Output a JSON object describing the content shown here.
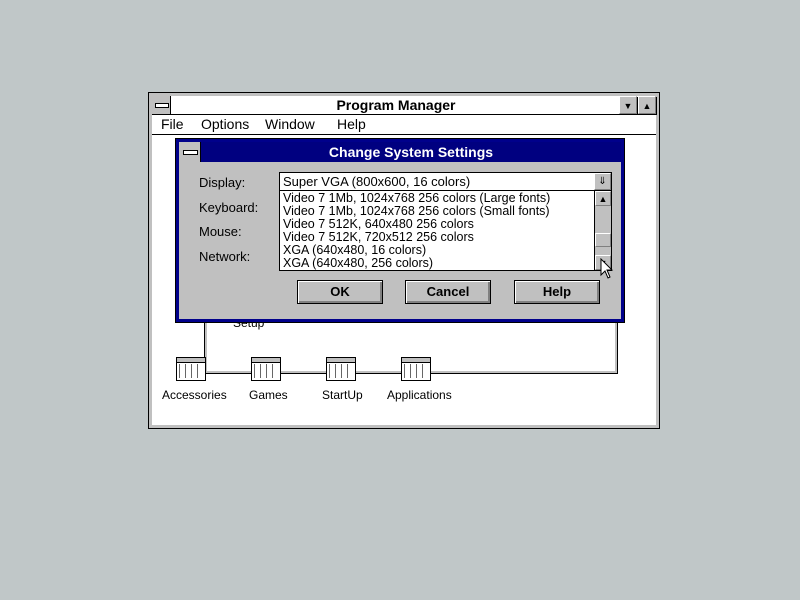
{
  "program_manager": {
    "title": "Program Manager",
    "menu": [
      {
        "label": "File"
      },
      {
        "label": "Options"
      },
      {
        "label": "Window"
      },
      {
        "label": "Help"
      }
    ],
    "min_glyph": "▼",
    "max_glyph": "▲",
    "group_window": {
      "setup_label": "Setup"
    },
    "groups": [
      {
        "label": "Accessories",
        "icon": "program-group-icon"
      },
      {
        "label": "Games",
        "icon": "program-group-icon"
      },
      {
        "label": "StartUp",
        "icon": "program-group-icon"
      },
      {
        "label": "Applications",
        "icon": "program-group-icon"
      }
    ]
  },
  "dialog": {
    "title": "Change System Settings",
    "labels": {
      "display": "Display:",
      "keyboard": "Keyboard:",
      "mouse": "Mouse:",
      "network": "Network:"
    },
    "display_value": "Super VGA (800x600, 16 colors)",
    "display_options": [
      "Video 7 1Mb, 1024x768 256 colors (Large fonts)",
      "Video 7 1Mb, 1024x768 256 colors (Small fonts)",
      "Video 7 512K, 640x480 256 colors",
      "Video 7 512K, 720x512 256 colors",
      "XGA (640x480, 16 colors)",
      "XGA (640x480, 256 colors)"
    ],
    "dropdown_glyph": "⇓",
    "scroll_up_glyph": "▲",
    "scroll_down_glyph": "▼",
    "buttons": {
      "ok": "OK",
      "cancel": "Cancel",
      "help": "Help"
    }
  },
  "colors": {
    "desktop": "#c0c7c8",
    "dialog_title_bar": "#000080",
    "window_face": "#c0c0c0"
  }
}
